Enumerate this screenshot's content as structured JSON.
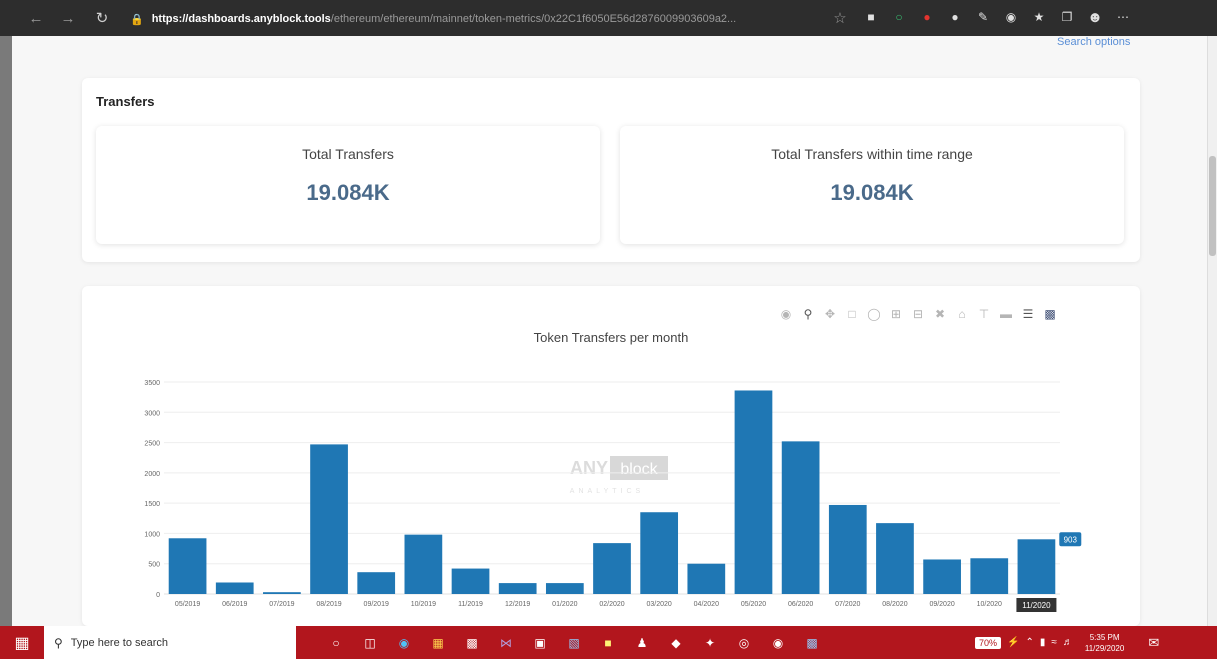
{
  "browser": {
    "url_host": "https://dashboards.anyblock.tools",
    "url_path": "/ethereum/ethereum/mainnet/token-metrics/0x22C1f6050E56d2876009903609a2..."
  },
  "header": {
    "search_options": "Search options"
  },
  "transfers": {
    "title": "Transfers",
    "total_label": "Total Transfers",
    "total_value": "19.084K",
    "range_label": "Total Transfers within time range",
    "range_value": "19.084K"
  },
  "chart_data": {
    "type": "bar",
    "title": "Token Transfers per month",
    "categories": [
      "05/2019",
      "06/2019",
      "07/2019",
      "08/2019",
      "09/2019",
      "10/2019",
      "11/2019",
      "12/2019",
      "01/2020",
      "02/2020",
      "03/2020",
      "04/2020",
      "05/2020",
      "06/2020",
      "07/2020",
      "08/2020",
      "09/2020",
      "10/2020",
      "11/2020"
    ],
    "values": [
      920,
      190,
      30,
      2470,
      360,
      980,
      420,
      180,
      180,
      840,
      1350,
      500,
      3360,
      2520,
      1470,
      1170,
      570,
      590,
      903
    ],
    "ylim": [
      0,
      3500
    ],
    "yticks": [
      "0",
      "500",
      "1000",
      "1500",
      "2000",
      "2500",
      "3000",
      "3500"
    ],
    "bar_color": "#1f77b4",
    "hover_value": "903",
    "hover_category": "11/2020",
    "watermark_top": "ANY",
    "watermark_box": "block",
    "watermark_sub": "ANALYTICS"
  },
  "taskbar": {
    "search_placeholder": "Type here to search",
    "battery": "70%",
    "time": "5:35 PM",
    "date": "11/29/2020"
  }
}
